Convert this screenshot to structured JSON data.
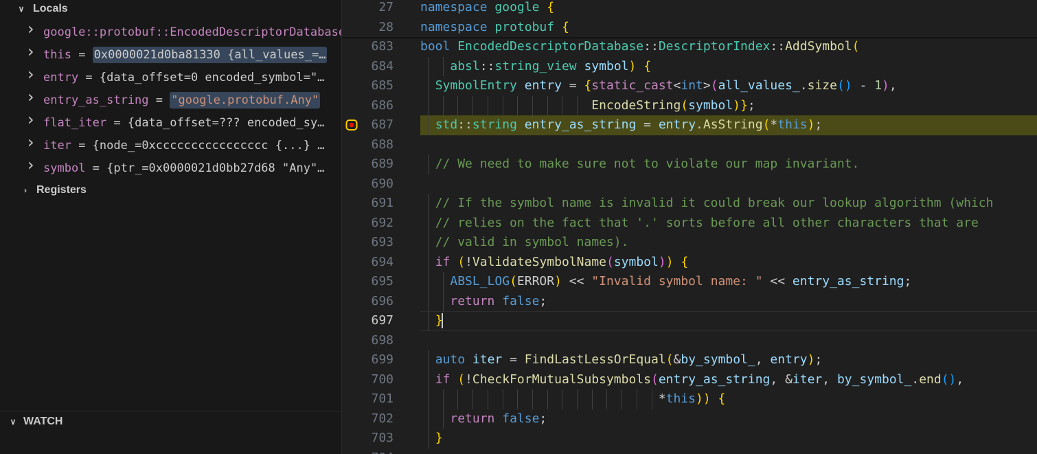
{
  "sidebar": {
    "locals_label": "Locals",
    "registers_label": "Registers",
    "watch_label": "WATCH",
    "variables": [
      {
        "name": "google::protobuf::EncodedDescriptorDatabase",
        "eq": "",
        "value": "",
        "highlight": false,
        "is_string": false
      },
      {
        "name": "this",
        "eq": " = ",
        "value": "0x0000021d0ba81330 {all_values_=…",
        "highlight": true,
        "is_string": false
      },
      {
        "name": "entry",
        "eq": " = ",
        "value": "{data_offset=0 encoded_symbol=\"…",
        "highlight": false,
        "is_string": false
      },
      {
        "name": "entry_as_string",
        "eq": " = ",
        "value": "\"google.protobuf.Any\"",
        "highlight": true,
        "is_string": true
      },
      {
        "name": "flat_iter",
        "eq": " = ",
        "value": "{data_offset=??? encoded_sy…",
        "highlight": false,
        "is_string": false
      },
      {
        "name": "iter",
        "eq": " = ",
        "value": "{node_=0xcccccccccccccccc {...} …",
        "highlight": false,
        "is_string": false
      },
      {
        "name": "symbol",
        "eq": " = ",
        "value": "{ptr_=0x0000021d0bb27d68 \"Any\"…",
        "highlight": false,
        "is_string": false
      }
    ]
  },
  "editor": {
    "current_line": "687",
    "cursor_line": "697",
    "lines": [
      {
        "num": "27",
        "text": "namespace google {"
      },
      {
        "num": "28",
        "text": "namespace protobuf {"
      },
      {
        "num": "683",
        "text": "bool EncodedDescriptorDatabase::DescriptorIndex::AddSymbol("
      },
      {
        "num": "684",
        "text": "    absl::string_view symbol) {"
      },
      {
        "num": "685",
        "text": "  SymbolEntry entry = {static_cast<int>(all_values_.size() - 1),"
      },
      {
        "num": "686",
        "text": "                       EncodeString(symbol)};"
      },
      {
        "num": "687",
        "text": "  std::string entry_as_string = entry.AsString(*this);"
      },
      {
        "num": "688",
        "text": ""
      },
      {
        "num": "689",
        "text": "  // We need to make sure not to violate our map invariant."
      },
      {
        "num": "690",
        "text": ""
      },
      {
        "num": "691",
        "text": "  // If the symbol name is invalid it could break our lookup algorithm (which"
      },
      {
        "num": "692",
        "text": "  // relies on the fact that '.' sorts before all other characters that are"
      },
      {
        "num": "693",
        "text": "  // valid in symbol names)."
      },
      {
        "num": "694",
        "text": "  if (!ValidateSymbolName(symbol)) {"
      },
      {
        "num": "695",
        "text": "    ABSL_LOG(ERROR) << \"Invalid symbol name: \" << entry_as_string;"
      },
      {
        "num": "696",
        "text": "    return false;"
      },
      {
        "num": "697",
        "text": "  }"
      },
      {
        "num": "698",
        "text": ""
      },
      {
        "num": "699",
        "text": "  auto iter = FindLastLessOrEqual(&by_symbol_, entry);"
      },
      {
        "num": "700",
        "text": "  if (!CheckForMutualSubsymbols(entry_as_string, &iter, by_symbol_.end(),"
      },
      {
        "num": "701",
        "text": "                                *this)) {"
      },
      {
        "num": "702",
        "text": "    return false;"
      },
      {
        "num": "703",
        "text": "  }"
      },
      {
        "num": "704",
        "text": ""
      }
    ]
  },
  "colors": {
    "keyword": "#569cd6",
    "control": "#c586c0",
    "type": "#4ec9b0",
    "function": "#dcdcaa",
    "variable": "#9cdcfe",
    "string": "#ce9178",
    "comment": "#6a9955",
    "current_line_bg": "#4b4b18",
    "breakpoint": "#ffcc00"
  }
}
